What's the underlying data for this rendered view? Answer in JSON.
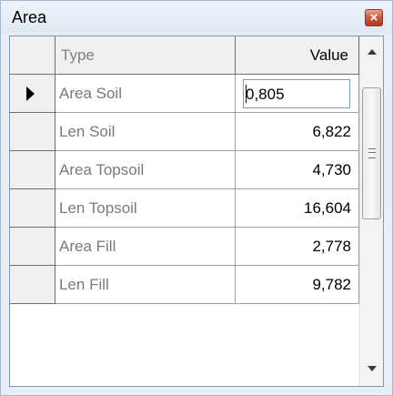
{
  "window": {
    "title": "Area",
    "close_glyph": "×"
  },
  "grid": {
    "columns": {
      "type": "Type",
      "value": "Value"
    },
    "rows": [
      {
        "type": "Area Soil",
        "value": "0,805"
      },
      {
        "type": "Len Soil",
        "value": "6,822"
      },
      {
        "type": "Area Topsoil",
        "value": "4,730"
      },
      {
        "type": "Len Topsoil",
        "value": "16,604"
      },
      {
        "type": "Area Fill",
        "value": "2,778"
      },
      {
        "type": "Len Fill",
        "value": "9,782"
      }
    ],
    "current_row_index": 0,
    "editing_value": "0,805"
  },
  "icons": {
    "close": "close-icon",
    "current_row": "row-indicator-arrow-icon",
    "scroll_up": "scroll-up-arrow-icon",
    "scroll_down": "scroll-down-arrow-icon"
  },
  "colors": {
    "title_bar": "#dfe8f3",
    "close_button": "#c9503a",
    "edit_border": "#7a9cc8"
  }
}
